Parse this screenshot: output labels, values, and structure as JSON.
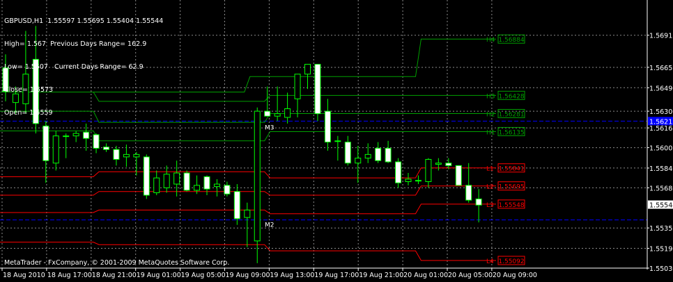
{
  "symbol_line": "GBPUSD,H1  1.55597 1.55695 1.55404 1.55544",
  "info": {
    "high": "High= 1.567",
    "prev_range": "Previous Days Range= 162.9",
    "low": "Low= 1.5507",
    "cur_range": "Current Days Range= 62.9",
    "close": "Close= 1.5573",
    "open": "Open= 1.5559"
  },
  "copyright": "MetaTrader - FxCompany, © 2001-2009 MetaQuotes Software Corp.",
  "colors": {
    "background": "#000000",
    "grid": "#8c8c8c",
    "axis": "#ffffff",
    "bull_body": "#000000",
    "bear_body": "#ffffff",
    "wick": "#00ff00",
    "resistance": "#00a000",
    "support": "#ff0000",
    "pivot_blue": "#0000ff",
    "current_price_bg": "#ffffff"
  },
  "chart_data": {
    "type": "candlestick",
    "symbol": "GBPUSD",
    "timeframe": "H1",
    "ylim": [
      1.5503,
      1.572
    ],
    "y_ticks": [
      "1.56915",
      "1.56655",
      "1.56490",
      "1.56300",
      "1.56165",
      "1.56005",
      "1.55840",
      "1.55680",
      "1.55355",
      "1.55190",
      "1.55030"
    ],
    "x_ticks": [
      "18 Aug 2010",
      "18 Aug 17:00",
      "18 Aug 21:00",
      "19 Aug 01:00",
      "19 Aug 05:00",
      "19 Aug 09:00",
      "19 Aug 13:00",
      "19 Aug 17:00",
      "19 Aug 21:00",
      "20 Aug 01:00",
      "20 Aug 05:00",
      "20 Aug 09:00"
    ],
    "current_price": "1.55544",
    "candles": [
      {
        "o": 1.5665,
        "h": 1.5676,
        "l": 1.5638,
        "c": 1.5646
      },
      {
        "o": 1.5637,
        "h": 1.565,
        "l": 1.5628,
        "c": 1.5644
      },
      {
        "o": 1.5636,
        "h": 1.5695,
        "l": 1.5628,
        "c": 1.566
      },
      {
        "o": 1.5672,
        "h": 1.5699,
        "l": 1.5612,
        "c": 1.562
      },
      {
        "o": 1.5618,
        "h": 1.5622,
        "l": 1.5572,
        "c": 1.559
      },
      {
        "o": 1.5588,
        "h": 1.5614,
        "l": 1.5582,
        "c": 1.561
      },
      {
        "o": 1.561,
        "h": 1.5612,
        "l": 1.5592,
        "c": 1.561
      },
      {
        "o": 1.561,
        "h": 1.5614,
        "l": 1.5605,
        "c": 1.5612
      },
      {
        "o": 1.5613,
        "h": 1.562,
        "l": 1.5598,
        "c": 1.5608
      },
      {
        "o": 1.5611,
        "h": 1.5612,
        "l": 1.5596,
        "c": 1.56
      },
      {
        "o": 1.5601,
        "h": 1.5604,
        "l": 1.5597,
        "c": 1.5599
      },
      {
        "o": 1.5599,
        "h": 1.5602,
        "l": 1.5586,
        "c": 1.5591
      },
      {
        "o": 1.5593,
        "h": 1.5603,
        "l": 1.5585,
        "c": 1.5595
      },
      {
        "o": 1.5593,
        "h": 1.5597,
        "l": 1.5578,
        "c": 1.5595
      },
      {
        "o": 1.5593,
        "h": 1.5595,
        "l": 1.5559,
        "c": 1.5562
      },
      {
        "o": 1.5564,
        "h": 1.5582,
        "l": 1.5562,
        "c": 1.5576
      },
      {
        "o": 1.5568,
        "h": 1.5586,
        "l": 1.5564,
        "c": 1.5579
      },
      {
        "o": 1.5571,
        "h": 1.559,
        "l": 1.5561,
        "c": 1.558
      },
      {
        "o": 1.558,
        "h": 1.5582,
        "l": 1.5565,
        "c": 1.5566
      },
      {
        "o": 1.5566,
        "h": 1.5578,
        "l": 1.5563,
        "c": 1.557
      },
      {
        "o": 1.5577,
        "h": 1.5578,
        "l": 1.5562,
        "c": 1.5567
      },
      {
        "o": 1.5569,
        "h": 1.5575,
        "l": 1.5561,
        "c": 1.5571
      },
      {
        "o": 1.557,
        "h": 1.5573,
        "l": 1.5561,
        "c": 1.5563
      },
      {
        "o": 1.5565,
        "h": 1.5571,
        "l": 1.5538,
        "c": 1.5543
      },
      {
        "o": 1.5544,
        "h": 1.5556,
        "l": 1.552,
        "c": 1.555
      },
      {
        "o": 1.5525,
        "h": 1.5633,
        "l": 1.5507,
        "c": 1.563
      },
      {
        "o": 1.563,
        "h": 1.565,
        "l": 1.5627,
        "c": 1.5626
      },
      {
        "o": 1.5626,
        "h": 1.565,
        "l": 1.5622,
        "c": 1.5628
      },
      {
        "o": 1.5625,
        "h": 1.5645,
        "l": 1.562,
        "c": 1.5632
      },
      {
        "o": 1.564,
        "h": 1.566,
        "l": 1.5625,
        "c": 1.566
      },
      {
        "o": 1.566,
        "h": 1.5668,
        "l": 1.5648,
        "c": 1.5668
      },
      {
        "o": 1.5668,
        "h": 1.5668,
        "l": 1.5622,
        "c": 1.5628
      },
      {
        "o": 1.563,
        "h": 1.564,
        "l": 1.5598,
        "c": 1.5605
      },
      {
        "o": 1.5606,
        "h": 1.561,
        "l": 1.559,
        "c": 1.5606
      },
      {
        "o": 1.5605,
        "h": 1.561,
        "l": 1.5586,
        "c": 1.5588
      },
      {
        "o": 1.5588,
        "h": 1.5602,
        "l": 1.5572,
        "c": 1.5592
      },
      {
        "o": 1.5592,
        "h": 1.5604,
        "l": 1.5588,
        "c": 1.5595
      },
      {
        "o": 1.56,
        "h": 1.5605,
        "l": 1.5588,
        "c": 1.559
      },
      {
        "o": 1.56,
        "h": 1.5606,
        "l": 1.5588,
        "c": 1.5589
      },
      {
        "o": 1.5589,
        "h": 1.5592,
        "l": 1.5568,
        "c": 1.5572
      },
      {
        "o": 1.5573,
        "h": 1.558,
        "l": 1.557,
        "c": 1.5575
      },
      {
        "o": 1.5574,
        "h": 1.5578,
        "l": 1.5571,
        "c": 1.5574
      },
      {
        "o": 1.5573,
        "h": 1.5592,
        "l": 1.5568,
        "c": 1.5591
      },
      {
        "o": 1.5587,
        "h": 1.5592,
        "l": 1.5582,
        "c": 1.5588
      },
      {
        "o": 1.5588,
        "h": 1.5592,
        "l": 1.5583,
        "c": 1.5586
      },
      {
        "o": 1.5586,
        "h": 1.5586,
        "l": 1.557,
        "c": 1.557
      },
      {
        "o": 1.557,
        "h": 1.5588,
        "l": 1.5556,
        "c": 1.5558
      },
      {
        "o": 1.5559,
        "h": 1.5567,
        "l": 1.554,
        "c": 1.5554
      }
    ],
    "levels": [
      {
        "label": "H4",
        "price_label": "1.56884",
        "color": "resistance",
        "steps": [
          [
            0,
            1.56455
          ],
          [
            24,
            1.5658
          ],
          [
            41,
            1.56884
          ]
        ],
        "text_pos": 1.56884
      },
      {
        "label": "H3",
        "price_label": "1.56428",
        "color": "resistance",
        "steps": [
          [
            0,
            1.56455
          ],
          [
            9,
            1.5638
          ],
          [
            26,
            1.56428
          ]
        ],
        "text_pos": 1.56428
      },
      {
        "label": "H2",
        "price_label": "1.56281",
        "color": "resistance",
        "steps": [
          [
            0,
            1.563
          ],
          [
            9,
            1.5621
          ],
          [
            26,
            1.56281
          ]
        ],
        "text_pos": 1.56281
      },
      {
        "label": "H1",
        "price_label": "1.56135",
        "color": "resistance",
        "steps": [
          [
            0,
            1.5614
          ],
          [
            9,
            1.5606
          ],
          [
            26,
            1.56135
          ]
        ],
        "text_pos": 1.56135
      },
      {
        "label": "L1",
        "price_label": "1.55841",
        "color": "support",
        "steps": [
          [
            0,
            1.5577
          ],
          [
            9,
            1.5581
          ],
          [
            26,
            1.5576
          ],
          [
            41,
            1.55841
          ]
        ],
        "text_pos": 1.55841
      },
      {
        "label": "L2",
        "price_label": "1.55695",
        "color": "support",
        "steps": [
          [
            0,
            1.5562
          ],
          [
            9,
            1.5565
          ],
          [
            26,
            1.5562
          ],
          [
            41,
            1.55695
          ]
        ],
        "text_pos": 1.55695
      },
      {
        "label": "L3",
        "price_label": "1.55548",
        "color": "support",
        "steps": [
          [
            0,
            1.5548
          ],
          [
            9,
            1.555
          ],
          [
            26,
            1.5547
          ],
          [
            41,
            1.55548
          ]
        ],
        "text_pos": 1.55548
      },
      {
        "label": "L4",
        "price_label": "1.55092",
        "color": "support",
        "steps": [
          [
            0,
            1.5524
          ],
          [
            9,
            1.5522
          ],
          [
            26,
            1.5517
          ],
          [
            41,
            1.55092
          ]
        ],
        "text_pos": 1.55092
      }
    ],
    "pivot_lines": [
      {
        "label": "M3",
        "price": 1.5622
      },
      {
        "label": "M2",
        "price": 1.5542
      }
    ],
    "pivot_price_label": "1.56215"
  }
}
